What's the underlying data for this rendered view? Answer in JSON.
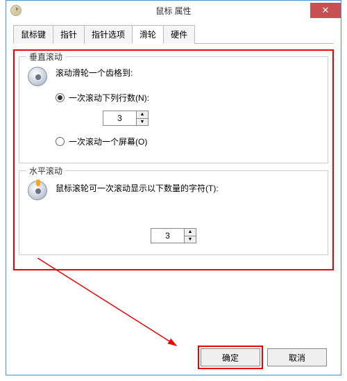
{
  "title": "鼠标 属性",
  "tabs": {
    "t0": "鼠标键",
    "t1": "指针",
    "t2": "指针选项",
    "t3": "滑轮",
    "t4": "硬件"
  },
  "vertical": {
    "group_title": "垂直滚动",
    "heading": "滚动滑轮一个齿格到:",
    "opt_lines": "一次滚动下列行数(N):",
    "lines_value": "3",
    "opt_screen": "一次滚动一个屏幕(O)"
  },
  "horizontal": {
    "group_title": "水平滚动",
    "heading": "鼠标滚轮可一次滚动显示以下数量的字符(T):",
    "value": "3"
  },
  "buttons": {
    "ok": "确定",
    "cancel": "取消"
  }
}
